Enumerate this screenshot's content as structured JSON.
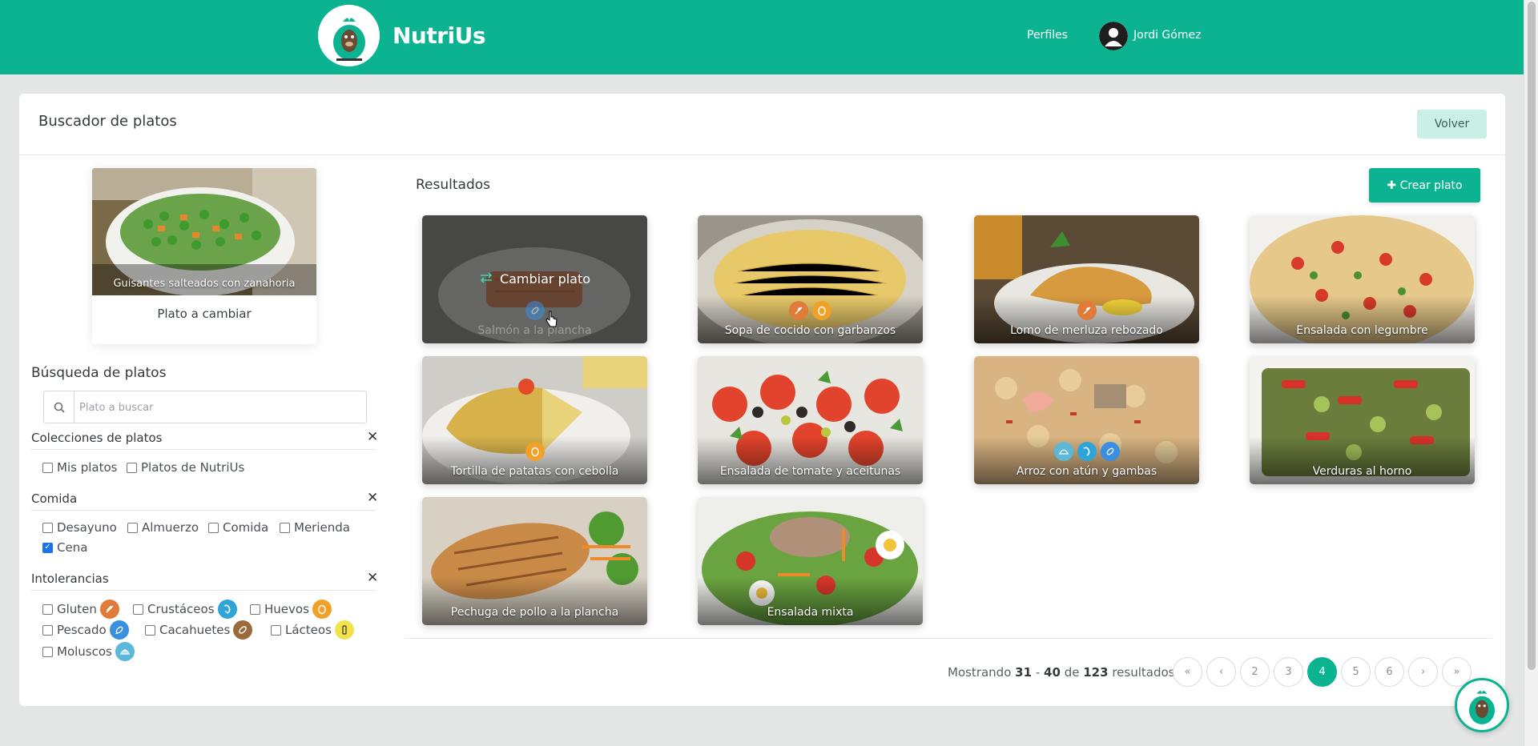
{
  "header": {
    "brand": "NutriUs",
    "nav_profiles": "Perfiles",
    "user_name": "Jordi Gómez",
    "bg_color": "#0bb391"
  },
  "page": {
    "title": "Buscador de platos",
    "back_label": "Volver"
  },
  "dish_to_change": {
    "name": "Guisantes salteados con zanahoria",
    "subtitle": "Plato a cambiar"
  },
  "search": {
    "title": "Búsqueda de platos",
    "placeholder": "Plato a buscar"
  },
  "filters": {
    "collections": {
      "label": "Colecciones de platos",
      "options": [
        {
          "label": "Mis platos",
          "checked": false
        },
        {
          "label": "Platos de NutriUs",
          "checked": false
        }
      ]
    },
    "meal": {
      "label": "Comida",
      "options": [
        {
          "label": "Desayuno",
          "checked": false
        },
        {
          "label": "Almuerzo",
          "checked": false
        },
        {
          "label": "Comida",
          "checked": false
        },
        {
          "label": "Merienda",
          "checked": false
        },
        {
          "label": "Cena",
          "checked": true
        }
      ]
    },
    "intolerances": {
      "label": "Intolerancias",
      "options": [
        {
          "label": "Gluten",
          "checked": false,
          "icon": "wheat-icon",
          "color": "#e07b39"
        },
        {
          "label": "Crustáceos",
          "checked": false,
          "icon": "shrimp-icon",
          "color": "#2fa4d9"
        },
        {
          "label": "Huevos",
          "checked": false,
          "icon": "egg-icon",
          "color": "#f0a12a"
        },
        {
          "label": "Pescado",
          "checked": false,
          "icon": "fish-icon",
          "color": "#3b8fe0"
        },
        {
          "label": "Cacahuetes",
          "checked": false,
          "icon": "peanut-icon",
          "color": "#9b6a3c"
        },
        {
          "label": "Lácteos",
          "checked": false,
          "icon": "milk-icon",
          "color": "#f2e24b"
        },
        {
          "label": "Moluscos",
          "checked": false,
          "icon": "shell-icon",
          "color": "#5bb8d9"
        }
      ]
    }
  },
  "results": {
    "title": "Resultados",
    "create_label": "Crear plato",
    "change_label": "Cambiar plato",
    "dishes": [
      {
        "name": "Salmón a la plancha",
        "allergens": [
          "fish-icon"
        ],
        "hovered": true
      },
      {
        "name": "Sopa de cocido con garbanzos",
        "allergens": [
          "wheat-icon",
          "egg-icon"
        ]
      },
      {
        "name": "Lomo de merluza rebozado",
        "allergens": [
          "wheat-icon"
        ]
      },
      {
        "name": "Ensalada con legumbre",
        "allergens": []
      },
      {
        "name": "Tortilla de patatas con cebolla",
        "allergens": [
          "egg-icon"
        ]
      },
      {
        "name": "Ensalada de tomate y aceitunas",
        "allergens": []
      },
      {
        "name": "Arroz con atún y gambas",
        "allergens": [
          "shell-icon",
          "shrimp-icon",
          "fish-icon"
        ]
      },
      {
        "name": "Verduras al horno",
        "allergens": []
      },
      {
        "name": "Pechuga de pollo a la plancha",
        "allergens": []
      },
      {
        "name": "Ensalada mixta",
        "allergens": []
      }
    ]
  },
  "pagination": {
    "showing_prefix": "Mostrando",
    "from": "31",
    "sep": "-",
    "to": "40",
    "of": "de",
    "total": "123",
    "suffix": "resultados",
    "pages": [
      "2",
      "3",
      "4",
      "5",
      "6"
    ],
    "current": "4",
    "first": "«",
    "prev": "‹",
    "next": "›",
    "last": "»"
  }
}
